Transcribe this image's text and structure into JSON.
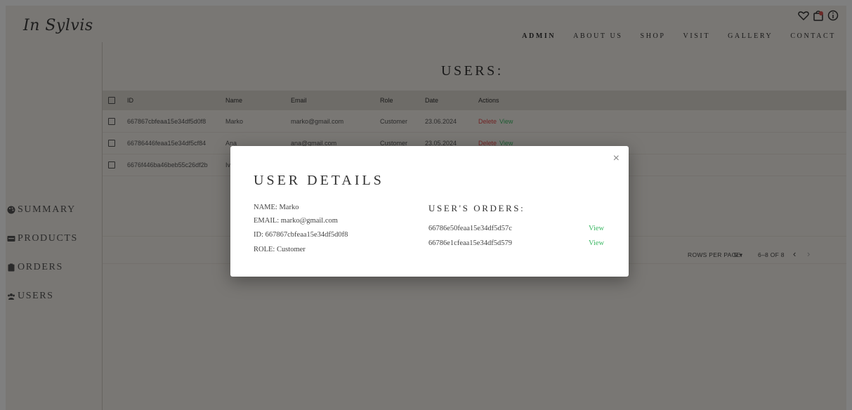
{
  "brand": {
    "logo": "In Sylvis"
  },
  "header": {
    "icons": [
      "heart-icon",
      "bag-icon",
      "info-icon"
    ],
    "nav": [
      "ADMIN",
      "ABOUT US",
      "SHOP",
      "VISIT",
      "GALLERY",
      "CONTACT"
    ]
  },
  "sidebar": {
    "items": [
      {
        "label": "SUMMARY",
        "icon": "palette-icon"
      },
      {
        "label": "PRODUCTS",
        "icon": "tray-icon"
      },
      {
        "label": "ORDERS",
        "icon": "clipboard-icon"
      },
      {
        "label": "USERS",
        "icon": "users-icon"
      }
    ]
  },
  "main": {
    "title": "USERS:",
    "columns": [
      "ID",
      "Name",
      "Email",
      "Role",
      "Date",
      "Actions"
    ],
    "rows": [
      {
        "id": "667867cbfeaa15e34df5d0f8",
        "name": "Marko",
        "email": "marko@gmail.com",
        "role": "Customer",
        "date": "23.06.2024",
        "delete": "Delete",
        "view": "View"
      },
      {
        "id": "66786446feaa15e34df5cf84",
        "name": "Ana",
        "email": "ana@gmail.com",
        "role": "Customer",
        "date": "23.05.2024",
        "delete": "Delete",
        "view": "View"
      },
      {
        "id": "6676f446ba46beb55c26df2b",
        "name": "Iv",
        "email": "",
        "role": "",
        "date": "",
        "delete": "",
        "view": ""
      }
    ],
    "pagination": {
      "rows_per_page_label": "ROWS PER PAGE:",
      "rows_per_page_value": "5",
      "range": "6–8 OF 8",
      "prev": "‹",
      "next": "›"
    }
  },
  "modal": {
    "close": "×",
    "title": "USER DETAILS",
    "name": "NAME: Marko",
    "email": "EMAIL: marko@gmail.com",
    "id": "ID: 667867cbfeaa15e34df5d0f8",
    "role": "ROLE: Customer",
    "orders_title": "USER'S ORDERS:",
    "orders": [
      {
        "id": "66786e50feaa15e34df5d57c",
        "action": "View"
      },
      {
        "id": "66786e1cfeaa15e34df5d579",
        "action": "View"
      }
    ]
  },
  "colors": {
    "background": "#f3efe9",
    "accent_green": "#3db864",
    "danger_red": "#e04848",
    "overlay": "rgba(0,0,0,0.5)"
  }
}
